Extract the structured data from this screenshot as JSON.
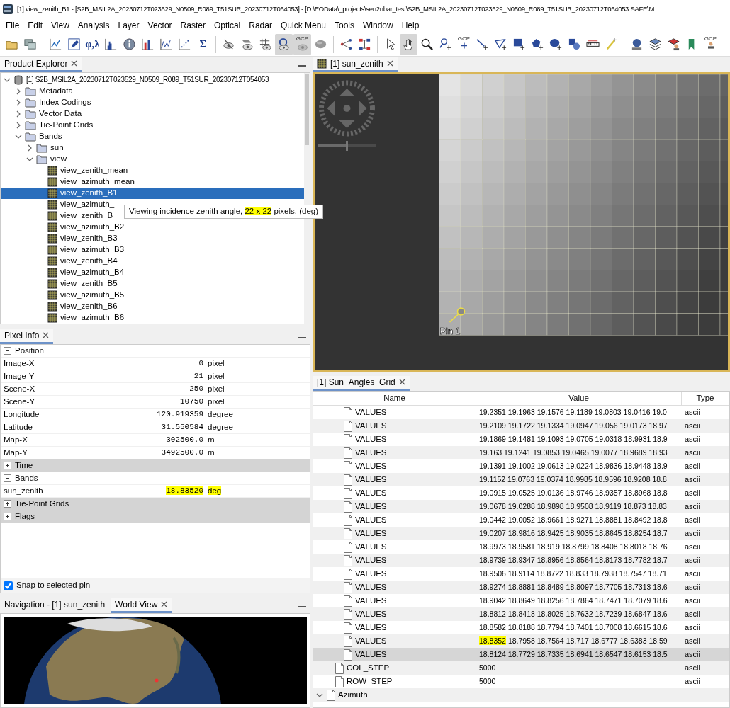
{
  "window": {
    "title": "[1] view_zenith_B1 - [S2B_MSIL2A_20230712T023529_N0509_R089_T51SUR_20230712T054053] - [D:\\EOData\\_projects\\sen2nbar_test\\S2B_MSIL2A_20230712T023529_N0509_R089_T51SUR_20230712T054053.SAFE\\M"
  },
  "menu": [
    "File",
    "Edit",
    "View",
    "Analysis",
    "Layer",
    "Vector",
    "Raster",
    "Optical",
    "Radar",
    "Quick Menu",
    "Tools",
    "Window",
    "Help"
  ],
  "toolbar": [
    [
      {
        "selected": false
      },
      {
        "selected": false
      }
    ],
    [
      {
        "selected": false
      },
      {
        "selected": false
      },
      {
        "label": "φ,λ",
        "selected": false
      },
      {
        "selected": false
      },
      {
        "selected": false
      },
      {
        "selected": false
      },
      {
        "selected": false
      },
      {
        "selected": false
      },
      {
        "label": "Σ",
        "selected": false
      }
    ],
    [
      {
        "selected": false
      },
      {
        "selected": false
      },
      {
        "selected": false
      },
      {
        "selected": true
      },
      {
        "label": "GCP",
        "selected": true
      },
      {
        "selected": false
      }
    ],
    [
      {
        "selected": false
      },
      {
        "selected": false
      }
    ],
    [
      {
        "selected": false
      },
      {
        "selected": true
      },
      {
        "selected": false
      },
      {
        "selected": false
      },
      {
        "label": "GCP",
        "selected": false
      },
      {
        "selected": false
      },
      {
        "selected": false
      },
      {
        "selected": false
      },
      {
        "selected": false
      },
      {
        "selected": false
      },
      {
        "selected": false
      },
      {
        "selected": false
      },
      {
        "selected": false
      }
    ],
    [
      {
        "selected": false
      },
      {
        "selected": false
      },
      {
        "selected": false
      },
      {
        "selected": false
      },
      {
        "label": "GCP",
        "selected": false
      }
    ]
  ],
  "product_explorer": {
    "tab": {
      "label": "Product Explorer",
      "selected": true,
      "closable": true
    },
    "tree": [
      {
        "kind": "product",
        "label": "[1] S2B_MSIL2A_20230712T023529_N0509_R089_T51SUR_20230712T054053",
        "expanded": true,
        "selected": false,
        "children": [
          {
            "kind": "folder",
            "label": "Metadata",
            "expanded": false,
            "selected": false
          },
          {
            "kind": "folder",
            "label": "Index Codings",
            "expanded": false,
            "selected": false
          },
          {
            "kind": "folder",
            "label": "Vector Data",
            "expanded": false,
            "selected": false
          },
          {
            "kind": "folder",
            "label": "Tie-Point Grids",
            "expanded": false,
            "selected": false
          },
          {
            "kind": "folder",
            "label": "Bands",
            "expanded": true,
            "selected": false,
            "children": [
              {
                "kind": "folder",
                "label": "sun",
                "expanded": false,
                "selected": false
              },
              {
                "kind": "folder",
                "label": "view",
                "expanded": true,
                "selected": false,
                "children": [
                  {
                    "kind": "band",
                    "label": "view_zenith_mean",
                    "selected": false
                  },
                  {
                    "kind": "band",
                    "label": "view_azimuth_mean",
                    "selected": false
                  },
                  {
                    "kind": "band",
                    "label": "view_zenith_B1",
                    "selected": true
                  },
                  {
                    "kind": "band",
                    "label": "view_azimuth_",
                    "selected": false
                  },
                  {
                    "kind": "band",
                    "label": "view_zenith_B",
                    "selected": false
                  },
                  {
                    "kind": "band",
                    "label": "view_azimuth_B2",
                    "selected": false
                  },
                  {
                    "kind": "band",
                    "label": "view_zenith_B3",
                    "selected": false
                  },
                  {
                    "kind": "band",
                    "label": "view_azimuth_B3",
                    "selected": false
                  },
                  {
                    "kind": "band",
                    "label": "view_zenith_B4",
                    "selected": false
                  },
                  {
                    "kind": "band",
                    "label": "view_azimuth_B4",
                    "selected": false
                  },
                  {
                    "kind": "band",
                    "label": "view_zenith_B5",
                    "selected": false
                  },
                  {
                    "kind": "band",
                    "label": "view_azimuth_B5",
                    "selected": false
                  },
                  {
                    "kind": "band",
                    "label": "view_zenith_B6",
                    "selected": false
                  },
                  {
                    "kind": "band",
                    "label": "view_azimuth_B6",
                    "selected": false
                  }
                ]
              }
            ]
          }
        ]
      }
    ],
    "tooltip": {
      "parts": [
        {
          "text": "Viewing incidence zenith angle, ",
          "highlighted": false
        },
        {
          "text": "22 x 22",
          "highlighted": true
        },
        {
          "text": " pixels,  (deg)",
          "highlighted": false
        }
      ]
    }
  },
  "pixel_info": {
    "tab": {
      "label": "Pixel Info",
      "selected": true,
      "closable": true
    },
    "groups": [
      {
        "title": "Position",
        "expanded": true,
        "rows": [
          {
            "label": "Image-X",
            "value": "0",
            "unit": "pixel",
            "highlighted": false
          },
          {
            "label": "Image-Y",
            "value": "21",
            "unit": "pixel",
            "highlighted": false
          },
          {
            "label": "Scene-X",
            "value": "250",
            "unit": "pixel",
            "highlighted": false
          },
          {
            "label": "Scene-Y",
            "value": "10750",
            "unit": "pixel",
            "highlighted": false
          },
          {
            "label": "Longitude",
            "value": "120.919359",
            "unit": "degree",
            "highlighted": false
          },
          {
            "label": "Latitude",
            "value": "31.550584",
            "unit": "degree",
            "highlighted": false
          },
          {
            "label": "Map-X",
            "value": "302500.0",
            "unit": "m",
            "highlighted": false
          },
          {
            "label": "Map-Y",
            "value": "3492500.0",
            "unit": "m",
            "highlighted": false
          }
        ]
      },
      {
        "title": "Time",
        "expanded": false
      },
      {
        "title": "Bands",
        "expanded": true,
        "rows": [
          {
            "label": "sun_zenith",
            "value": "18.83520",
            "unit": "deg",
            "highlighted": true
          }
        ]
      },
      {
        "title": "Tie-Point Grids",
        "expanded": false
      },
      {
        "title": "Flags",
        "expanded": false
      }
    ],
    "snap": {
      "label": "Snap to selected pin",
      "checked": true
    }
  },
  "navigation": {
    "tabs": [
      {
        "label": "Navigation - [1] sun_zenith",
        "selected": false,
        "closable": false
      },
      {
        "label": "World View",
        "selected": true,
        "closable": true
      }
    ]
  },
  "image_view": {
    "tab": {
      "label": "[1] sun_zenith",
      "selected": true,
      "closable": true
    },
    "pin_label": "Pin 1",
    "zoom_slider": {
      "level": 0.5
    }
  },
  "grid_table": {
    "tab": {
      "label": "[1] Sun_Angles_Grid",
      "selected": true,
      "closable": true
    },
    "columns": [
      "Name",
      "Value",
      "Type"
    ],
    "rows": [
      {
        "children": [
          {
            "children": [
              {
                "name": "VALUES",
                "value": "19.2351 19.1963 19.1576 19.1189 19.0803 19.0416 19.0",
                "type": "ascii",
                "selected": false
              },
              {
                "name": "VALUES",
                "value": "19.2109 19.1722 19.1334 19.0947 19.056 19.0173 18.97",
                "type": "ascii",
                "selected": false
              },
              {
                "name": "VALUES",
                "value": "19.1869 19.1481 19.1093 19.0705 19.0318 18.9931 18.9",
                "type": "ascii",
                "selected": false
              },
              {
                "name": "VALUES",
                "value": "19.163 19.1241 19.0853 19.0465 19.0077 18.9689 18.93",
                "type": "ascii",
                "selected": false
              },
              {
                "name": "VALUES",
                "value": "19.1391 19.1002 19.0613 19.0224 18.9836 18.9448 18.9",
                "type": "ascii",
                "selected": false
              },
              {
                "name": "VALUES",
                "value": "19.1152 19.0763 19.0374 18.9985 18.9596 18.9208 18.8",
                "type": "ascii",
                "selected": false
              },
              {
                "name": "VALUES",
                "value": "19.0915 19.0525 19.0136 18.9746 18.9357 18.8968 18.8",
                "type": "ascii",
                "selected": false
              },
              {
                "name": "VALUES",
                "value": "19.0678 19.0288 18.9898 18.9508 18.9119 18.873 18.83",
                "type": "ascii",
                "selected": false
              },
              {
                "name": "VALUES",
                "value": "19.0442 19.0052 18.9661 18.9271 18.8881 18.8492 18.8",
                "type": "ascii",
                "selected": false
              },
              {
                "name": "VALUES",
                "value": "19.0207 18.9816 18.9425 18.9035 18.8645 18.8254 18.7",
                "type": "ascii",
                "selected": false
              },
              {
                "name": "VALUES",
                "value": "18.9973 18.9581 18.919 18.8799 18.8408 18.8018 18.76",
                "type": "ascii",
                "selected": false
              },
              {
                "name": "VALUES",
                "value": "18.9739 18.9347 18.8956 18.8564 18.8173 18.7782 18.7",
                "type": "ascii",
                "selected": false
              },
              {
                "name": "VALUES",
                "value": "18.9506 18.9114 18.8722 18.833 18.7938 18.7547 18.71",
                "type": "ascii",
                "selected": false
              },
              {
                "name": "VALUES",
                "value": "18.9274 18.8881 18.8489 18.8097 18.7705 18.7313 18.6",
                "type": "ascii",
                "selected": false
              },
              {
                "name": "VALUES",
                "value": "18.9042 18.8649 18.8256 18.7864 18.7471 18.7079 18.6",
                "type": "ascii",
                "selected": false
              },
              {
                "name": "VALUES",
                "value": "18.8812 18.8418 18.8025 18.7632 18.7239 18.6847 18.6",
                "type": "ascii",
                "selected": false
              },
              {
                "name": "VALUES",
                "value": "18.8582 18.8188 18.7794 18.7401 18.7008 18.6615 18.6",
                "type": "ascii",
                "selected": false
              },
              {
                "name": "VALUES",
                "value_parts": [
                  {
                    "text": "18.8352",
                    "highlighted": true
                  },
                  {
                    "text": " 18.7958 18.7564 18.717 18.6777 18.6383 18.59",
                    "highlighted": false
                  }
                ],
                "type": "ascii",
                "selected": false
              },
              {
                "name": "VALUES",
                "value": "18.8124 18.7729 18.7335 18.6941 18.6547 18.6153 18.5",
                "type": "ascii",
                "selected": true
              }
            ]
          },
          {
            "name": "COL_STEP",
            "value": "5000",
            "type": "ascii",
            "selected": false
          },
          {
            "name": "ROW_STEP",
            "value": "5000",
            "type": "ascii",
            "selected": false
          }
        ]
      },
      {
        "name": "Azimuth",
        "expanded": true,
        "selected": false
      }
    ]
  }
}
